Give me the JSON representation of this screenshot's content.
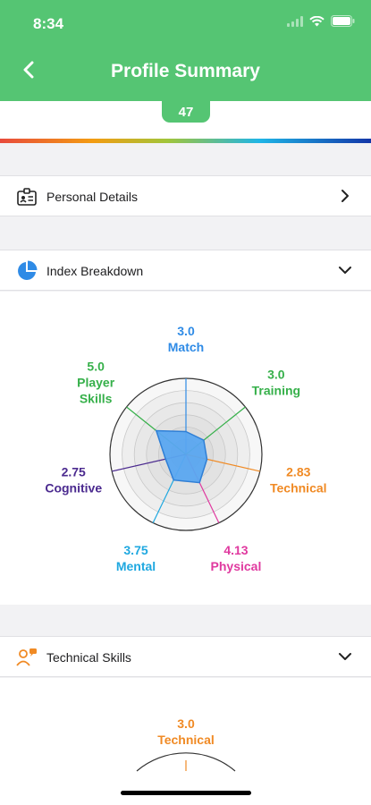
{
  "status": {
    "time": "8:34"
  },
  "header": {
    "title": "Profile Summary"
  },
  "score": {
    "value": "47"
  },
  "sections": {
    "personal": {
      "label": "Personal Details"
    },
    "index": {
      "label": "Index Breakdown"
    },
    "technical": {
      "label": "Technical Skills"
    }
  },
  "colors": {
    "header_green": "#55c573",
    "radar_fill": "#5aa7f0"
  },
  "radar": {
    "max": 10,
    "axes": [
      {
        "value": "3.0",
        "label": "Match",
        "color": "#2f8be6"
      },
      {
        "value": "3.0",
        "label": "Training",
        "color": "#36b04a"
      },
      {
        "value": "2.83",
        "label": "Technical",
        "color": "#f08a24"
      },
      {
        "value": "4.13",
        "label": "Physical",
        "color": "#e0399f"
      },
      {
        "value": "3.75",
        "label": "Mental",
        "color": "#1fa8e0"
      },
      {
        "value": "2.75",
        "label": "Cognitive",
        "color": "#4b2a8f"
      },
      {
        "value": "5.0",
        "label": "Player\nSkills",
        "color": "#36b04a"
      }
    ]
  },
  "technical_preview": {
    "value": "3.0",
    "label": "Technical",
    "color": "#f08a24"
  }
}
